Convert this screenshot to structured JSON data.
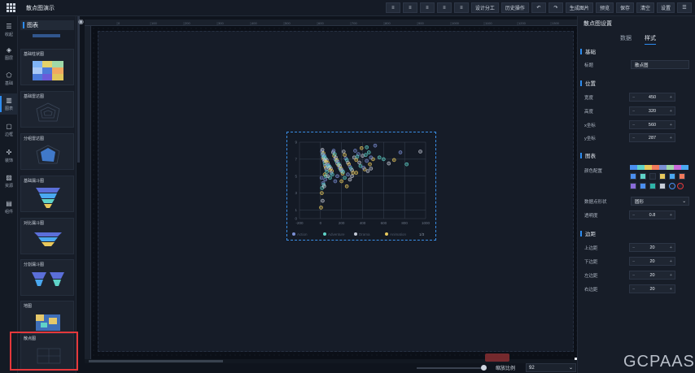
{
  "app_title": "散点图演示",
  "toolbar": {
    "design_label": "设计分工",
    "history_label": "历史操作",
    "generate_label": "生成图片",
    "preview_label": "预览",
    "save_label": "保存",
    "clear_label": "清空",
    "settings_label": "设置"
  },
  "nav": [
    {
      "label": "收起",
      "icon": "collapse-icon"
    },
    {
      "label": "图层",
      "icon": "layers-icon"
    },
    {
      "label": "基础",
      "icon": "basic-icon"
    },
    {
      "label": "图表",
      "icon": "chart-icon"
    },
    {
      "label": "边框",
      "icon": "border-icon"
    },
    {
      "label": "装饰",
      "icon": "decoration-icon"
    },
    {
      "label": "资源",
      "icon": "resource-icon"
    },
    {
      "label": "组件",
      "icon": "component-icon"
    }
  ],
  "panel": {
    "title": "图表",
    "cards": [
      "基础柱状图",
      "基础雷达图",
      "分组雷达图",
      "基础漏斗图",
      "对比漏斗图",
      "分割漏斗图",
      "地图",
      "散点图"
    ]
  },
  "ruler_marks": [
    "0",
    "100",
    "200",
    "300",
    "400",
    "500",
    "600",
    "700",
    "800",
    "900",
    "1000",
    "1100",
    "1200",
    "1300",
    "1400"
  ],
  "chart_data": {
    "type": "scatter",
    "xlim": [
      -200,
      1000
    ],
    "ylim": [
      0,
      9
    ],
    "xticks": [
      "-200",
      "0",
      "200",
      "400",
      "600",
      "800",
      "1000"
    ],
    "yticks": [
      "0",
      "1",
      "3",
      "5",
      "7",
      "9"
    ],
    "series": [
      {
        "name": "Action",
        "color": "#7b8fd4"
      },
      {
        "name": "Adventure",
        "color": "#5fd3c8"
      },
      {
        "name": "Drama",
        "color": "#c3c8d4"
      },
      {
        "name": "Animation",
        "color": "#e8c85c"
      }
    ],
    "legend_page": "1/3",
    "legend_position": "bottom",
    "points": [
      [
        15,
        7.9
      ],
      [
        20,
        7.6
      ],
      [
        25,
        7.2
      ],
      [
        30,
        7.0
      ],
      [
        35,
        6.8
      ],
      [
        40,
        6.5
      ],
      [
        45,
        6.2
      ],
      [
        50,
        6.0
      ],
      [
        55,
        5.8
      ],
      [
        60,
        5.5
      ],
      [
        18,
        8.1
      ],
      [
        28,
        7.7
      ],
      [
        38,
        7.4
      ],
      [
        48,
        7.1
      ],
      [
        58,
        6.9
      ],
      [
        68,
        6.6
      ],
      [
        78,
        6.3
      ],
      [
        88,
        6.1
      ],
      [
        98,
        5.9
      ],
      [
        108,
        5.6
      ],
      [
        22,
        7.5
      ],
      [
        32,
        7.3
      ],
      [
        42,
        6.9
      ],
      [
        52,
        6.7
      ],
      [
        62,
        6.4
      ],
      [
        72,
        6.2
      ],
      [
        82,
        6.0
      ],
      [
        92,
        5.7
      ],
      [
        102,
        5.4
      ],
      [
        112,
        5.2
      ],
      [
        120,
        7.8
      ],
      [
        130,
        7.4
      ],
      [
        140,
        7.0
      ],
      [
        150,
        6.8
      ],
      [
        160,
        6.5
      ],
      [
        170,
        6.3
      ],
      [
        180,
        6.0
      ],
      [
        190,
        5.8
      ],
      [
        200,
        5.6
      ],
      [
        210,
        5.3
      ],
      [
        125,
        8.0
      ],
      [
        135,
        7.6
      ],
      [
        145,
        7.2
      ],
      [
        155,
        6.9
      ],
      [
        165,
        6.7
      ],
      [
        175,
        6.4
      ],
      [
        185,
        6.2
      ],
      [
        195,
        5.9
      ],
      [
        205,
        5.7
      ],
      [
        215,
        5.5
      ],
      [
        220,
        7.9
      ],
      [
        230,
        7.5
      ],
      [
        240,
        7.1
      ],
      [
        250,
        6.9
      ],
      [
        260,
        6.6
      ],
      [
        270,
        6.4
      ],
      [
        280,
        6.1
      ],
      [
        290,
        5.9
      ],
      [
        300,
        5.7
      ],
      [
        310,
        5.4
      ],
      [
        10,
        4.8
      ],
      [
        15,
        3.6
      ],
      [
        20,
        2.1
      ],
      [
        12,
        3.0
      ],
      [
        25,
        4.2
      ],
      [
        30,
        4.0
      ],
      [
        35,
        3.8
      ],
      [
        40,
        5.2
      ],
      [
        45,
        4.6
      ],
      [
        50,
        5.0
      ],
      [
        320,
        7.2
      ],
      [
        340,
        6.9
      ],
      [
        360,
        7.6
      ],
      [
        380,
        6.2
      ],
      [
        400,
        7.4
      ],
      [
        420,
        5.8
      ],
      [
        440,
        6.8
      ],
      [
        460,
        7.8
      ],
      [
        480,
        5.9
      ],
      [
        500,
        7.0
      ],
      [
        330,
        8.0
      ],
      [
        350,
        7.3
      ],
      [
        370,
        6.6
      ],
      [
        390,
        8.3
      ],
      [
        410,
        6.0
      ],
      [
        430,
        7.5
      ],
      [
        450,
        5.6
      ],
      [
        470,
        6.4
      ],
      [
        520,
        8.6
      ],
      [
        560,
        7.2
      ],
      [
        300,
        5.0
      ],
      [
        340,
        5.4
      ],
      [
        260,
        5.2
      ],
      [
        230,
        4.8
      ],
      [
        280,
        4.6
      ],
      [
        200,
        4.4
      ],
      [
        160,
        5.0
      ],
      [
        600,
        7.0
      ],
      [
        650,
        6.5
      ],
      [
        700,
        6.9
      ],
      [
        760,
        7.8
      ],
      [
        820,
        6.4
      ],
      [
        950,
        7.9
      ],
      [
        250,
        3.8
      ],
      [
        140,
        4.4
      ],
      [
        90,
        4.8
      ],
      [
        70,
        5.0
      ],
      [
        5,
        1.3
      ],
      [
        480,
        7.2
      ],
      [
        440,
        8.4
      ]
    ]
  }
}
